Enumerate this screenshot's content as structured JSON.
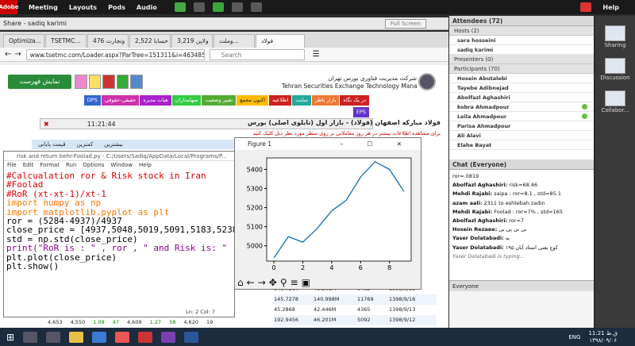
{
  "topbar": {
    "logo": "Adobe",
    "menus": [
      "Meeting",
      "Layouts",
      "Pods",
      "Audio"
    ],
    "help": "Help"
  },
  "share": {
    "title": "Share - sadiq karimi",
    "fullscreen": "Full Screen"
  },
  "browser": {
    "tabs": [
      "Optimiza...",
      "TSETMC...",
      "وتجارت 476",
      "خسابا 2,522",
      "ولاپن 3,219",
      "وملت...",
      "فولاد"
    ],
    "url": "www.tsetmc.com/Loader.aspx?ParTree=151311&i=46348559193",
    "search_placeholder": "Search"
  },
  "tsetmc": {
    "org_fa": "شرکت مدیریت فناوری بورس تهران",
    "org_en": "Tehran Securities Exchange Technology Management Co",
    "show_list": "نمایش فهرست",
    "nav": [
      "در یک نگاه",
      "بازار ناظر",
      "سایت",
      "اطلاعیه",
      "اکنون مجمع",
      "تغییر وضعیت",
      "سهامداران",
      "هیات مدیره",
      "حقیقی-حقوقی",
      "DPS",
      "EPS"
    ],
    "time": "11:21:44",
    "stock_title": "فولاد مبارکه اصفهان (فولاد) - بازار اول (تابلوی اصلی) بورس",
    "notice": "برای مشاهده اطلاعات بیشتر در هر روز معاملاتی بر روی سطر مورد نظر دبل کلیک کنید",
    "table_hdr": [
      "قیمت پایانی",
      "کمترین",
      "بیشترین"
    ],
    "rows": [
      [
        "4,653",
        "4,550",
        "1.09",
        "47",
        "4,609",
        "1.27",
        "58",
        "4,620",
        "19",
        "149.7264",
        "46.201M",
        "9462",
        "1398/9/12"
      ],
      [
        "",
        "",
        "",
        "",
        "",
        "",
        "",
        "",
        "",
        "145.7278",
        "140.998M",
        "11769",
        "1398/9/16"
      ],
      [
        "",
        "",
        "",
        "",
        "",
        "",
        "",
        "",
        "",
        "45.2868",
        "42.446M",
        "4365",
        "1398/9/13"
      ],
      [
        "",
        "",
        "",
        "",
        "",
        "",
        "",
        "",
        "",
        "192.9456",
        "46.201M",
        "5092",
        "1398/9/12"
      ]
    ],
    "ln_col": "Ln: 2  Col: 7"
  },
  "editor": {
    "title": "risk and return behr-Foolad.py - C:/Users/Sadiq/AppData/Local/Programs/P...",
    "menu": [
      "File",
      "Edit",
      "Format",
      "Run",
      "Options",
      "Window",
      "Help"
    ],
    "lines": [
      "#Calcualation ror & Risk stock in Iran",
      "#Foolad",
      "#RoR (xt-xt-1)/xt-1",
      "import numpy as np",
      "import matplotlib.pyplot as plt",
      "ror = (5284-4937)/4937",
      "close_price = [4937,5048,5019,5091,5183,5238",
      "std = np.std(close_price)",
      "print(\"RoR is : \" , ror , \" and Risk is: \" ,",
      "plt.plot(close_price)",
      "plt.show()"
    ]
  },
  "figure": {
    "title": "Figure 1"
  },
  "chart_data": {
    "type": "line",
    "x": [
      0,
      1,
      2,
      3,
      4,
      5,
      6,
      7,
      8,
      9
    ],
    "values": [
      4937,
      5048,
      5019,
      5091,
      5183,
      5238,
      5360,
      5440,
      5400,
      5284
    ],
    "xticks": [
      "0",
      "2",
      "4",
      "6",
      "8"
    ],
    "yticks": [
      "5000",
      "5100",
      "5200",
      "5300",
      "5400"
    ],
    "ylim": [
      4920,
      5460
    ],
    "xlim": [
      -0.5,
      9.5
    ],
    "color": "#1f77b4"
  },
  "attendees": {
    "header": "Attendees (72)",
    "hosts_label": "Hosts (2)",
    "hosts": [
      "sara hosseini",
      "sadiq karimi"
    ],
    "presenters_label": "Presenters (0)",
    "participants_label": "Participants (70)",
    "participants": [
      "Hosein Abutalebi",
      "Tayebe Adibnejad",
      "Abolfazl Aghashiri",
      "kobra Ahmadpour",
      "Leila Ahmadpour",
      "Parisa Ahmadpour",
      "Ali Alavi",
      "Elahe Bayat"
    ]
  },
  "chat": {
    "header": "Chat  (Everyone)",
    "messages": [
      {
        "who": "",
        "text": "ror=.0819"
      },
      {
        "who": "Abolfazl Aghashiri:",
        "text": "risk=68.46"
      },
      {
        "who": "Mehdi Rajabi:",
        "text": "saipa : ror=8.1 , std=85.1"
      },
      {
        "who": "azam aali:",
        "text": "2311 to eshtebah zadin"
      },
      {
        "who": "Mehdi Rajabi:",
        "text": "Foolad : ror=7% , std=165"
      },
      {
        "who": "Abolfazl Aghashiri:",
        "text": "ror=7"
      },
      {
        "who": "Hosein Rezaee:",
        "text": "نی نی پی بی"
      },
      {
        "who": "Yaser Dolatabadi:",
        "text": "یه"
      },
      {
        "who": "Yaser Dolatabadi:",
        "text": "کوچ یعنی استاد آنان ۱۹۵"
      }
    ],
    "typing": "Yaser Dolatabadi is typing...",
    "target": "Everyone"
  },
  "side": [
    "Sharing",
    "Discussion",
    "Collabor..."
  ],
  "taskbar": {
    "lang": "ENG",
    "time": "11:21 ق.ظ",
    "date": "۱۳۹۸/۰۹/۰۶"
  }
}
